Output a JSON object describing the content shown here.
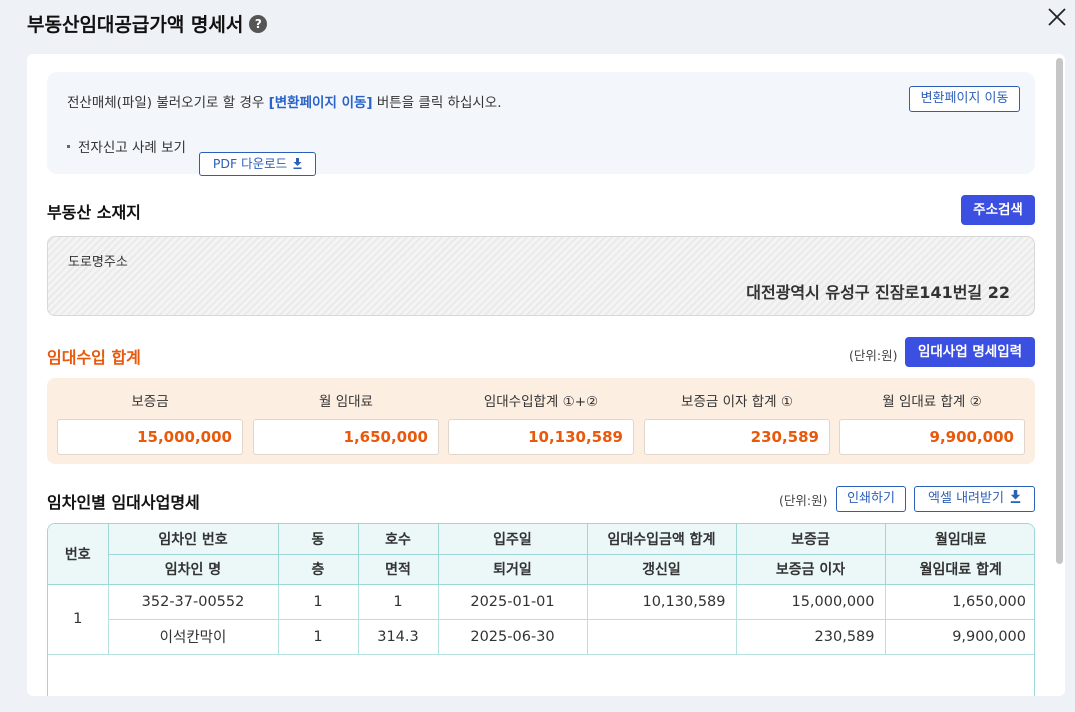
{
  "header": {
    "title": "부동산임대공급가액 명세서",
    "help_icon": "?"
  },
  "notice": {
    "line_prefix": "전산매체(파일) 불러오기로 할 경우 ",
    "line_highlight": "[변환페이지 이동]",
    "line_suffix": " 버튼을 클릭 하십시오.",
    "convert_button": "변환페이지 이동",
    "example_label": "전자신고 사례 보기",
    "pdf_button": "PDF 다운로드"
  },
  "location": {
    "title": "부동산 소재지",
    "search_button": "주소검색",
    "road_address_label": "도로명주소",
    "road_address_value": "대전광역시 유성구 진잠로141번길 22"
  },
  "income": {
    "title": "임대수입 합계",
    "unit": "(단위:원)",
    "detail_button": "임대사업 명세입력",
    "fields": [
      {
        "label": "보증금",
        "value": "15,000,000"
      },
      {
        "label": "월 임대료",
        "value": "1,650,000"
      },
      {
        "label": "임대수입합계 ①+②",
        "value": "10,130,589"
      },
      {
        "label": "보증금 이자 합계 ①",
        "value": "230,589"
      },
      {
        "label": "월 임대료 합계 ②",
        "value": "9,900,000"
      }
    ]
  },
  "tenants": {
    "title": "임차인별 임대사업명세",
    "unit": "(단위:원)",
    "print_button": "인쇄하기",
    "excel_button": "엑셀 내려받기",
    "header_row1": [
      "번호",
      "임차인 번호",
      "동",
      "호수",
      "입주일",
      "임대수입금액 합계",
      "보증금",
      "월임대료"
    ],
    "header_row2": [
      "임차인 명",
      "층",
      "면적",
      "퇴거일",
      "갱신일",
      "보증금 이자",
      "월임대료 합계"
    ],
    "rows": [
      {
        "no": "1",
        "line1": [
          "352-37-00552",
          "1",
          "1",
          "2025-01-01",
          "10,130,589",
          "15,000,000",
          "1,650,000"
        ],
        "line2": [
          "이석칸막이",
          "1",
          "314.3",
          "2025-06-30",
          "",
          "230,589",
          "9,900,000"
        ]
      }
    ]
  },
  "colors": {
    "accent": "#3b4fe0",
    "link": "#2c5fb8",
    "orange": "#e8590c",
    "table_border": "#9fd6d6",
    "table_header": "#ebf8f7"
  }
}
